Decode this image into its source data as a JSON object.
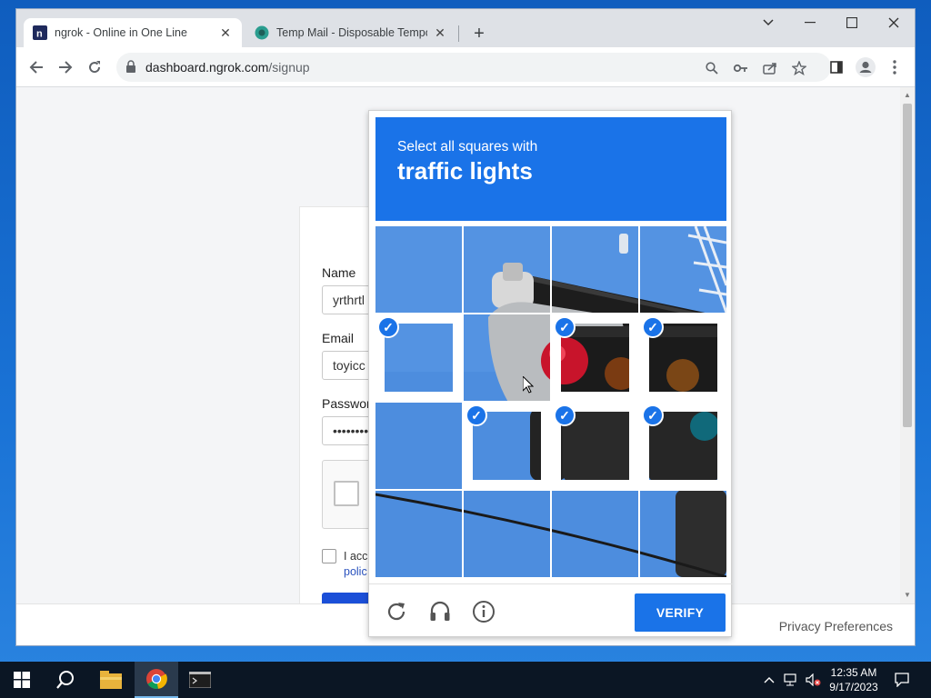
{
  "browser": {
    "tabs": [
      {
        "title": "ngrok - Online in One Line",
        "favicon": "ngrok-icon",
        "active": true
      },
      {
        "title": "Temp Mail - Disposable Tempora",
        "favicon": "tempmail-icon",
        "active": false
      }
    ],
    "url_host": "dashboard.ngrok.com",
    "url_path": "/signup"
  },
  "signup": {
    "name_label": "Name",
    "name_value": "yrthrtl",
    "email_label": "Email",
    "email_value": "toyicc",
    "password_label": "Passwor",
    "password_value": "••••••••",
    "terms_text": "I acc",
    "terms_link": "polic"
  },
  "captcha": {
    "instruction": "Select all squares with",
    "object": "traffic lights",
    "verify_label": "VERIFY",
    "selected_tiles": [
      4,
      6,
      7,
      9,
      10,
      11
    ],
    "accent": "#1a73e8"
  },
  "footer": {
    "privacy_label": "Privacy Preferences"
  },
  "taskbar": {
    "time": "12:35 AM",
    "date": "9/17/2023"
  }
}
